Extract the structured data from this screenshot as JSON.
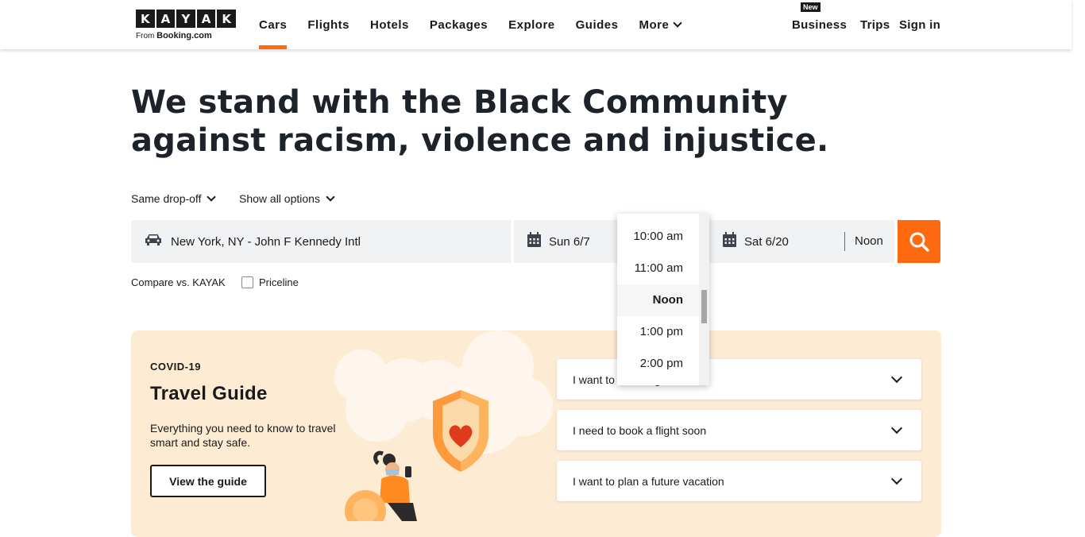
{
  "header": {
    "logo_letters": [
      "K",
      "A",
      "Y",
      "A",
      "K"
    ],
    "logo_from": "From",
    "logo_brand": "Booking.com",
    "nav": [
      {
        "label": "Cars",
        "active": true
      },
      {
        "label": "Flights"
      },
      {
        "label": "Hotels"
      },
      {
        "label": "Packages"
      },
      {
        "label": "Explore"
      },
      {
        "label": "Guides"
      },
      {
        "label": "More"
      }
    ],
    "new_badge": "New",
    "business": "Business",
    "trips": "Trips",
    "signin": "Sign in",
    "accent_color": "#ff690f"
  },
  "headline": "We stand with the Black Community against racism, violence and injustice.",
  "options": {
    "dropoff": "Same drop-off",
    "show_all": "Show all options"
  },
  "search": {
    "location": "New York, NY - John F Kennedy Intl",
    "pickup_date": "Sun 6/7",
    "dropoff_date": "Sat 6/20",
    "dropoff_time": "Noon",
    "search_icon": "search-icon"
  },
  "compare": {
    "label": "Compare vs. KAYAK",
    "priceline": "Priceline"
  },
  "time_dropdown": {
    "options": [
      "10:00 am",
      "11:00 am",
      "Noon",
      "1:00 pm",
      "2:00 pm"
    ],
    "selected": "Noon"
  },
  "covid": {
    "tag": "COVID-19",
    "title": "Travel Guide",
    "desc": "Everything you need to know to travel smart and stay safe.",
    "button": "View the guide",
    "accordions": [
      "I want to travel right now",
      "I need to book a flight soon",
      "I want to plan a future vacation"
    ]
  }
}
